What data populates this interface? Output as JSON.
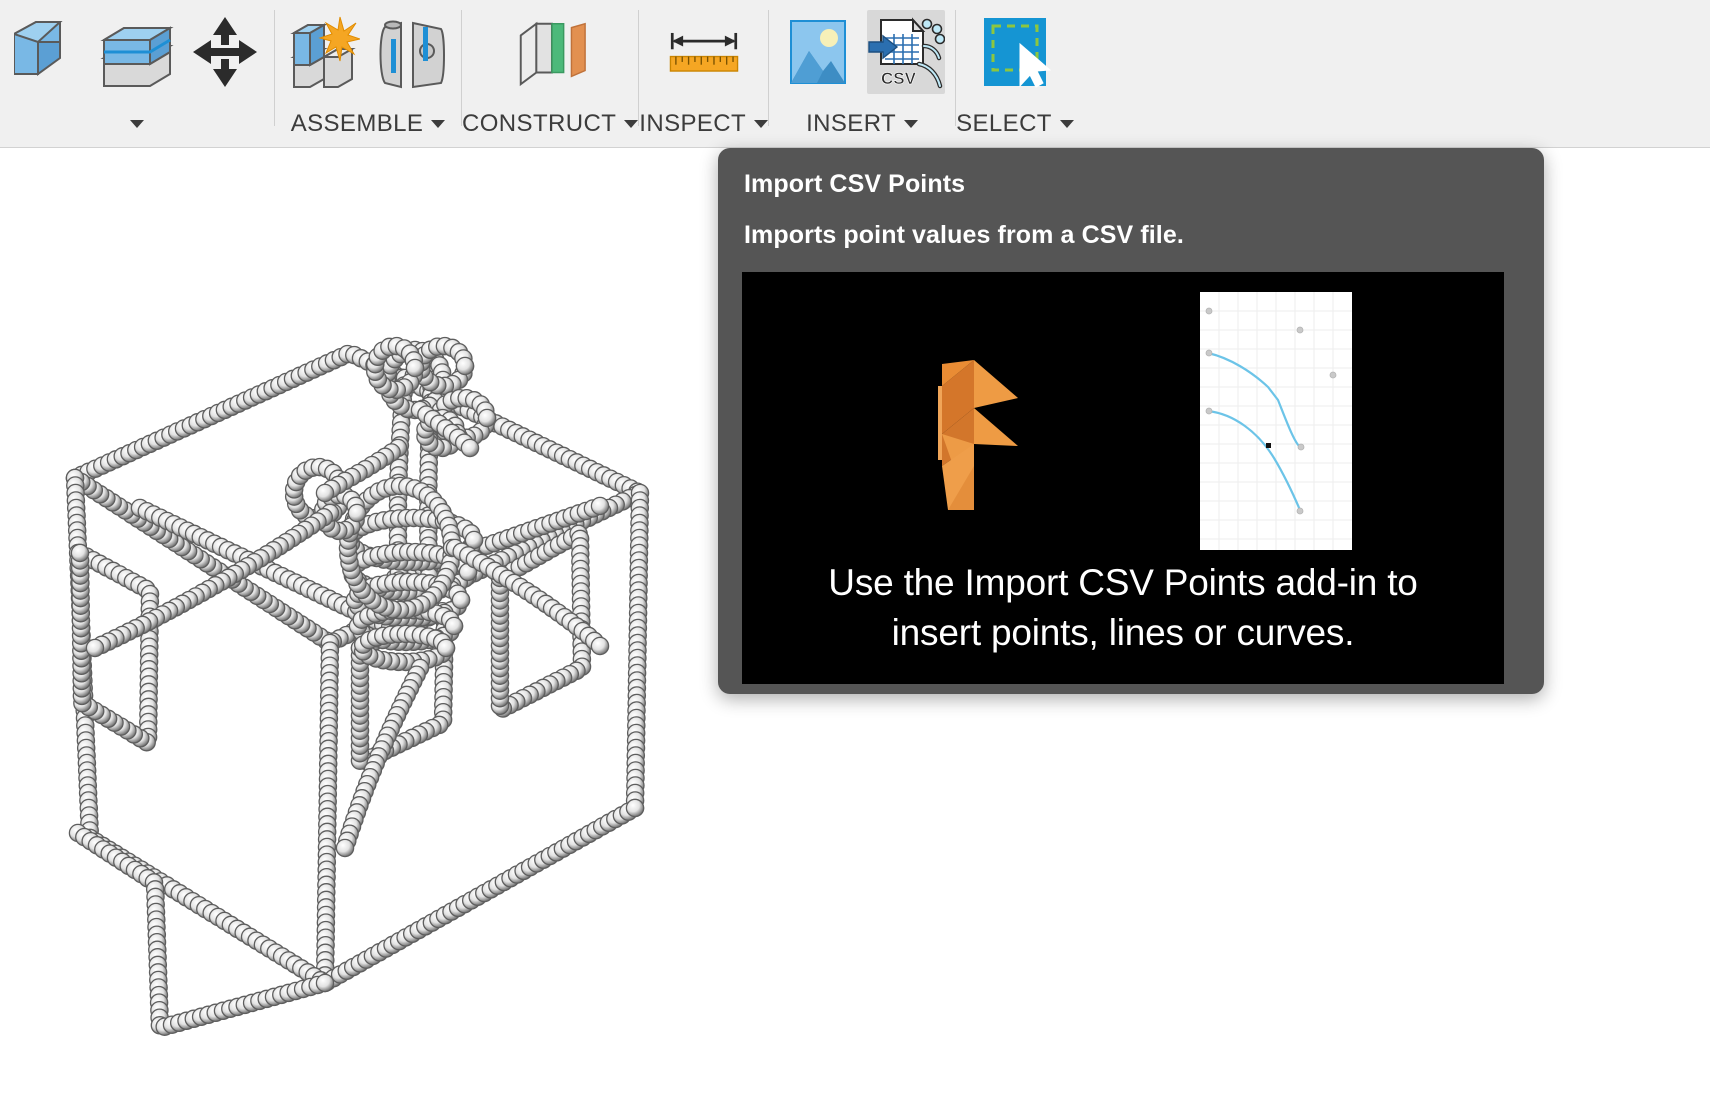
{
  "toolbar": {
    "groups": [
      {
        "id": "modify",
        "label": "",
        "has_caret": true,
        "icons": [
          {
            "name": "extrude-icon",
            "label": "Extrude"
          },
          {
            "name": "offset-face-icon",
            "label": "Offset Face"
          },
          {
            "name": "move-copy-icon",
            "label": "Move/Copy"
          }
        ]
      },
      {
        "id": "assemble",
        "label": "ASSEMBLE",
        "has_caret": true,
        "icons": [
          {
            "name": "new-component-icon",
            "label": "New Component"
          },
          {
            "name": "joint-icon",
            "label": "Joint"
          }
        ]
      },
      {
        "id": "construct",
        "label": "CONSTRUCT",
        "has_caret": true,
        "icons": [
          {
            "name": "offset-plane-icon",
            "label": "Offset Plane"
          }
        ]
      },
      {
        "id": "inspect",
        "label": "INSPECT",
        "has_caret": true,
        "icons": [
          {
            "name": "measure-icon",
            "label": "Measure"
          }
        ]
      },
      {
        "id": "insert",
        "label": "INSERT",
        "has_caret": true,
        "icons": [
          {
            "name": "insert-canvas-icon",
            "label": "Insert Canvas"
          },
          {
            "name": "import-csv-points-icon",
            "label": "Import CSV Points",
            "hovered": true
          }
        ]
      },
      {
        "id": "select",
        "label": "SELECT",
        "has_caret": true,
        "icons": [
          {
            "name": "select-window-icon",
            "label": "Select"
          }
        ]
      }
    ]
  },
  "tooltip": {
    "title": "Import CSV Points",
    "description": "Imports point values from a CSV file.",
    "caption_line1": "Use the Import CSV Points add-in to",
    "caption_line2": "insert points, lines or curves.",
    "logo_name": "fusion-360-logo",
    "sketch_name": "csv-curve-sketch-thumbnail"
  },
  "colors": {
    "tooltip_bg": "#555555",
    "media_bg": "#000000",
    "accent_orange": "#E8883A",
    "sketch_curve_blue": "#6CC4E8",
    "toolbar_bg": "#F0F0F0",
    "select_blue": "#1595D3",
    "construct_green": "#4CB97A",
    "construct_orange": "#E29050"
  },
  "canvas": {
    "model_name": "point-cloud-wireframe-model",
    "description": "3D wireframe model built from imported CSV point cloud"
  }
}
